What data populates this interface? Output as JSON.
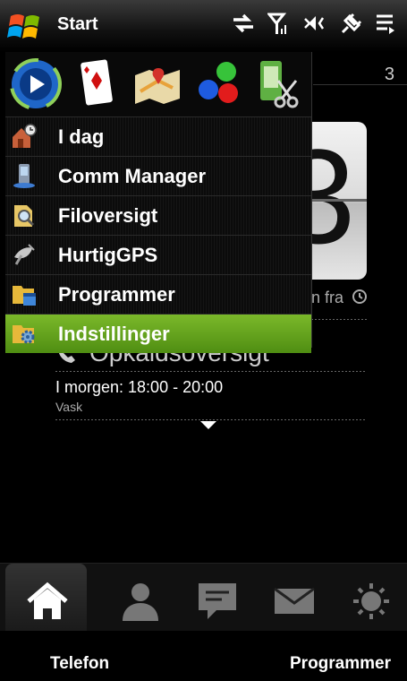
{
  "statusbar": {
    "title": "Start",
    "icons": [
      "windows-logo-icon",
      "data-sync-icon",
      "signal-icon",
      "speaker-muted-icon",
      "power-plug-icon",
      "menu-lines-icon"
    ]
  },
  "home": {
    "date_corner": "3",
    "clock_digit": "3",
    "alarm_text": "n fra",
    "calllog_label": "Opkaldsoversigt",
    "appointment_time": "I morgen: 18:00 - 20:00",
    "appointment_title": "Vask"
  },
  "startmenu": {
    "quick_icons": [
      "media-player-icon",
      "solitaire-icon",
      "maps-icon",
      "bubble-breaker-icon",
      "phone-scissors-icon"
    ],
    "items": [
      {
        "label": "I dag",
        "icon": "today-house-icon",
        "selected": false
      },
      {
        "label": "Comm Manager",
        "icon": "comm-manager-icon",
        "selected": false
      },
      {
        "label": "Filoversigt",
        "icon": "file-explorer-icon",
        "selected": false
      },
      {
        "label": "HurtigGPS",
        "icon": "satellite-icon",
        "selected": false
      },
      {
        "label": "Programmer",
        "icon": "programs-folder-icon",
        "selected": false
      },
      {
        "label": "Indstillinger",
        "icon": "settings-folder-icon",
        "selected": true
      }
    ]
  },
  "tabbar": {
    "tabs": [
      "home-icon",
      "contacts-icon",
      "messaging-icon",
      "email-icon",
      "weather-icon"
    ]
  },
  "softkeys": {
    "left": "Telefon",
    "right": "Programmer"
  },
  "colors": {
    "selection_green": "#6aa61f",
    "background": "#000000"
  }
}
